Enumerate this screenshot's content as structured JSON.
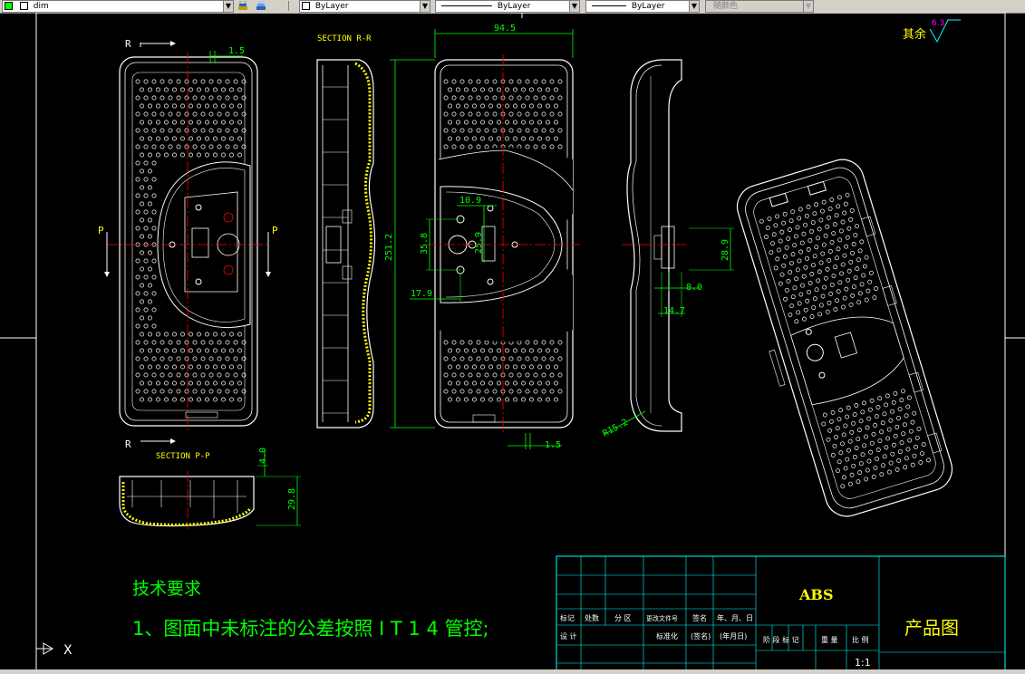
{
  "toolbar": {
    "layer_value": "dim",
    "color_value": "ByLayer",
    "linetype_value": "ByLayer",
    "lineweight_value": "ByLayer",
    "plotstyle_value": "随颜色"
  },
  "drawing": {
    "front_view": {
      "section_label_top": "R",
      "section_label_bottom": "R",
      "section_left": "P",
      "section_right": "P",
      "dim_wall": "1.5"
    },
    "section_rr": {
      "title": "SECTION R-R"
    },
    "rear_view": {
      "dim_width": "94.5",
      "dim_height": "251.2",
      "dim_hole_spacing": "10.9",
      "dim_35_8": "35.8",
      "dim_25_9": "25.9",
      "dim_17_9": "17.9",
      "dim_bottom": "1.5"
    },
    "side_view": {
      "dim_28_9": "28.9",
      "dim_8_0": "8.0",
      "dim_14_7": "14.7",
      "radius_label": "R15.2"
    },
    "section_pp": {
      "title": "SECTION P-P",
      "dim_4_0": "4.0",
      "dim_29_8": "29.8"
    },
    "roughness": {
      "label": "其余",
      "value": "6.3"
    },
    "notes": {
      "heading": "技术要求",
      "item1": "1、图面中未标注的公差按照 I T 1 4 管控;"
    },
    "title_block": {
      "material": "ABS",
      "drawing_title": "产品图",
      "scale": "1:1",
      "row1_col1": "标记",
      "row1_col2": "处数",
      "row1_col3": "分 区",
      "row1_col4": "更改文件号",
      "row1_col5": "签名",
      "row1_col6": "年、月、日",
      "row2_col1": "设 计",
      "row2_col2": "标准化",
      "row2_col3": "(签名)",
      "row2_col4": "(年月日)",
      "stage_labels": "阶 段 标 记",
      "weight_label": "重 量",
      "scale_label": "比 例"
    },
    "ucs": {
      "x_label": "X"
    }
  }
}
